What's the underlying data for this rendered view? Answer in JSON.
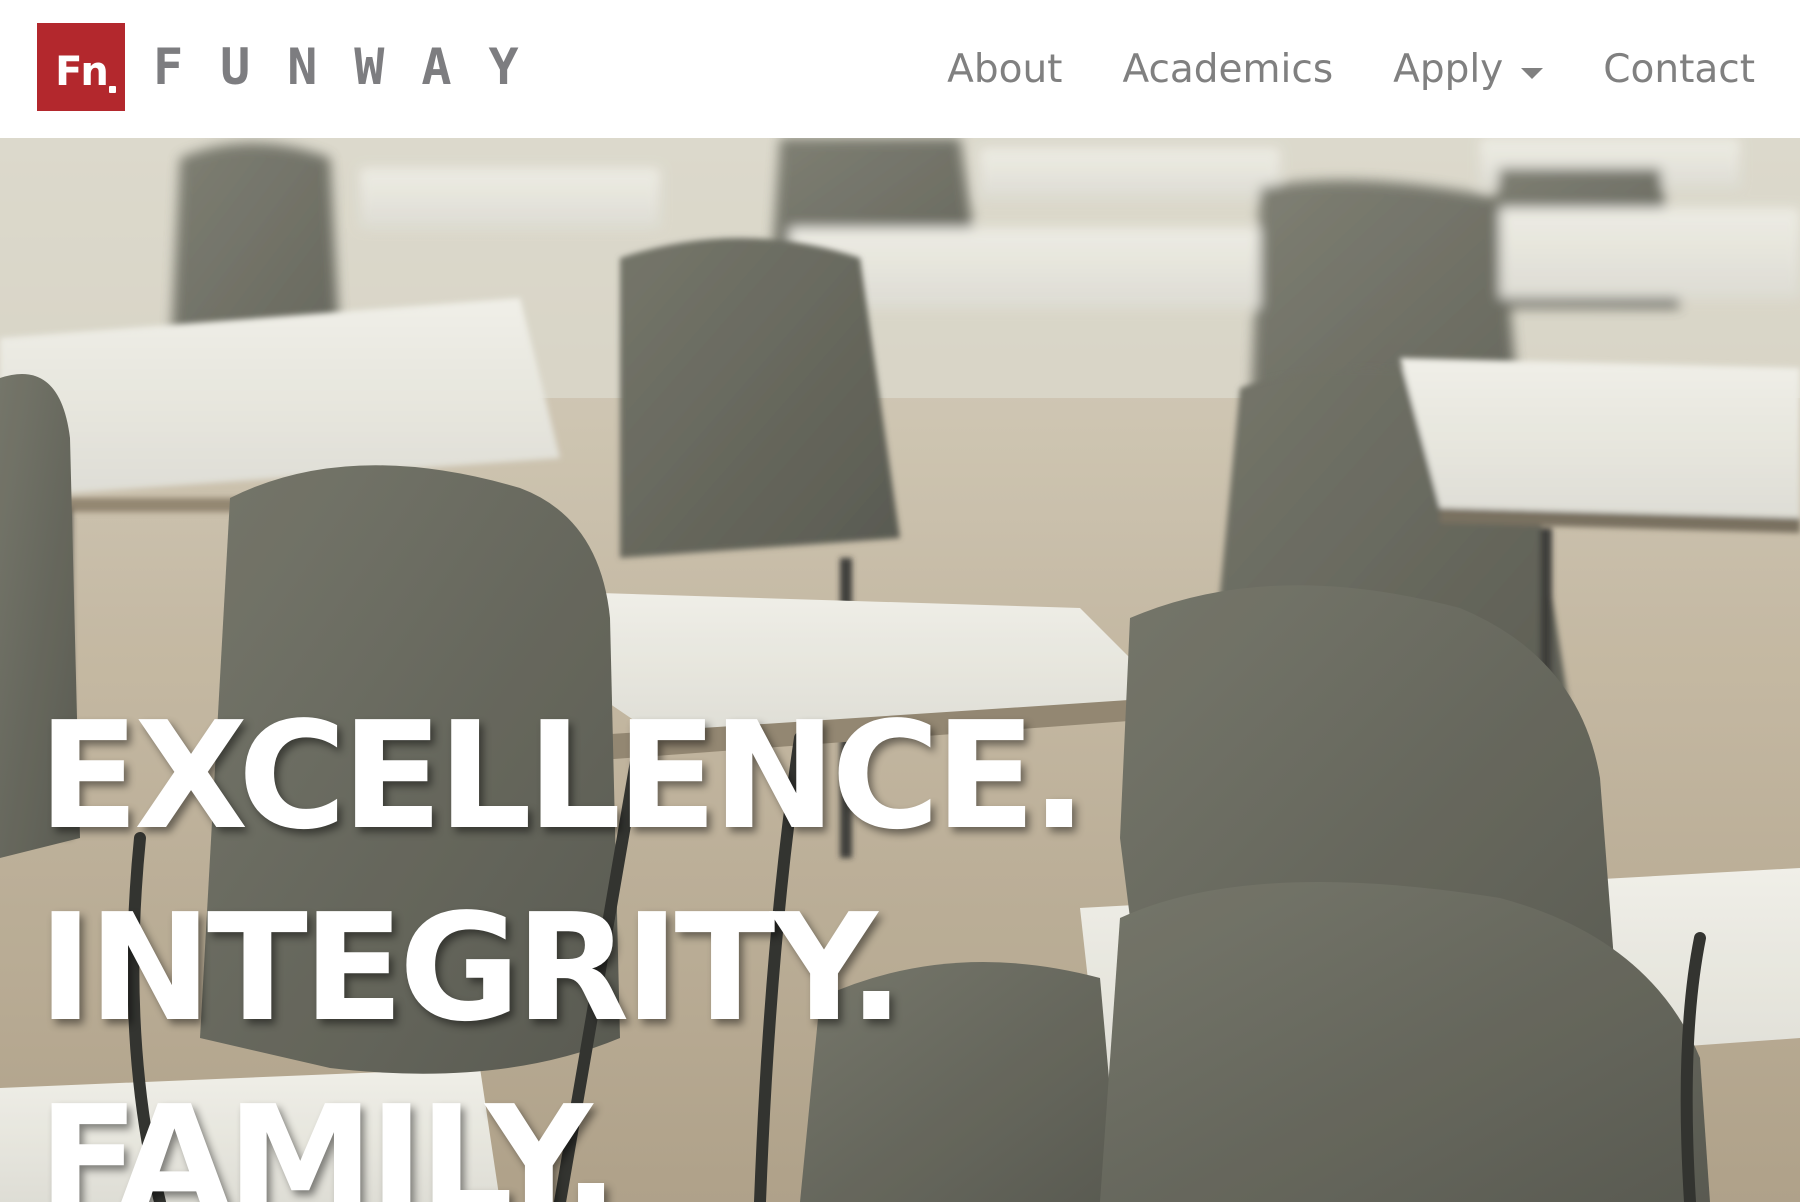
{
  "brand": {
    "mark_text": "Fn",
    "wordmark": "FUNWAY",
    "accent_color": "#b3282d",
    "wordmark_color": "#7d7d80"
  },
  "nav": {
    "items": [
      {
        "label": "About"
      },
      {
        "label": "Academics"
      },
      {
        "label": "Apply",
        "has_dropdown": true,
        "icon": "chevron-down-icon"
      },
      {
        "label": "Contact"
      }
    ],
    "text_color": "#808080"
  },
  "hero": {
    "lines": [
      "EXCELLENCE.",
      "INTEGRITY.",
      "FAMILY."
    ],
    "background": "classroom-desks-photo",
    "text_color": "#ffffff"
  }
}
